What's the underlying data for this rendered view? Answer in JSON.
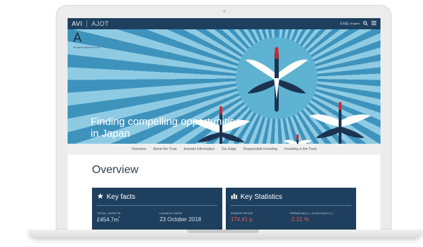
{
  "topbar": {
    "brand_primary": "AVI",
    "brand_secondary": "AJOT",
    "language": "日本語 | English",
    "search_icon": "search-icon",
    "menu_icon": "menu-icon"
  },
  "hero": {
    "logo_text": "A",
    "logo_subtitle": "AVI Japan Opportunity Trust",
    "headline": "Finding compelling opportunities in Japan"
  },
  "nav": {
    "items": [
      {
        "label": "Overview"
      },
      {
        "label": "About the Trust"
      },
      {
        "label": "Investor Information"
      },
      {
        "label": "Our Edge"
      },
      {
        "label": "Responsible Investing"
      },
      {
        "label": "Investing in the Trust"
      }
    ]
  },
  "main": {
    "title": "Overview",
    "key_facts": {
      "title": "Key facts",
      "total_assets_label": "TOTAL ASSETS:",
      "total_assets_value": "£454.7m",
      "total_assets_mark": "*",
      "launch_date_label": "LAUNCH DATE:",
      "launch_date_value": "23 October 2018"
    },
    "key_statistics": {
      "title": "Key Statistics",
      "share_price_label": "SHARE PRICE:",
      "share_price_value": "174.41 p",
      "premium_label": "PREMIUM(+) / DISCOUNT(-):",
      "premium_value": "-2.21 %"
    }
  },
  "colors": {
    "navy": "#1e3f5e",
    "sky_blue": "#5eb2d2",
    "negative_red": "#ef5a59"
  }
}
